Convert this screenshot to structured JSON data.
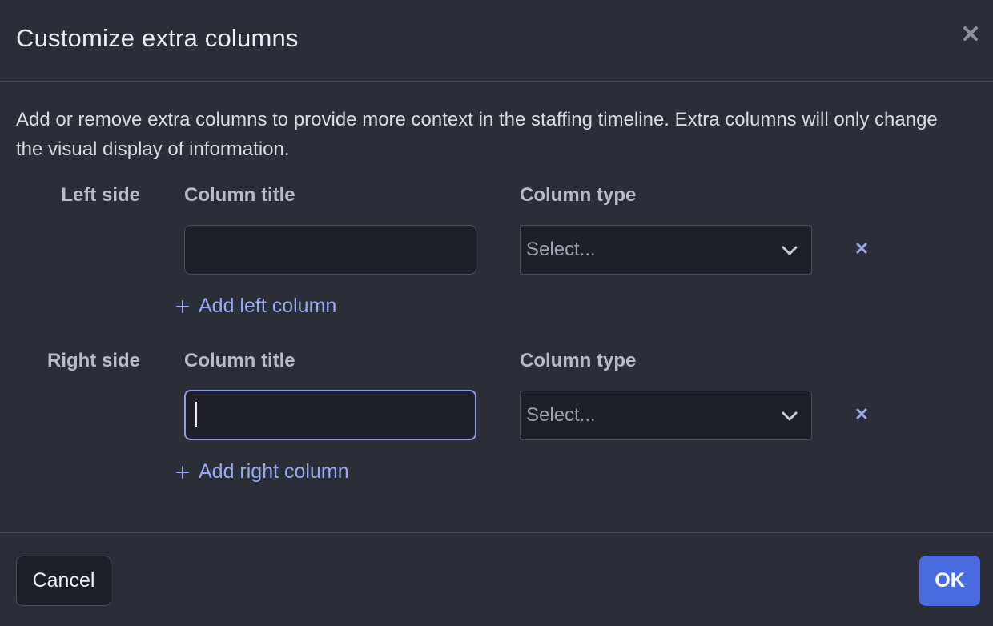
{
  "dialog": {
    "title": "Customize extra columns",
    "description": "Add or remove extra columns to provide more context in the staffing timeline. Extra columns will only change the visual display of information."
  },
  "left_side": {
    "label": "Left side",
    "column_title_label": "Column title",
    "column_type_label": "Column type",
    "column_title_value": "",
    "column_type_placeholder": "Select...",
    "add_label": "Add left column"
  },
  "right_side": {
    "label": "Right side",
    "column_title_label": "Column title",
    "column_type_label": "Column type",
    "column_title_value": "",
    "column_type_placeholder": "Select...",
    "add_label": "Add right column"
  },
  "footer": {
    "cancel_label": "Cancel",
    "ok_label": "OK"
  },
  "icons": {
    "close": "close-icon",
    "remove": "x-icon",
    "add": "plus-icon",
    "dropdown": "chevron-down-icon"
  },
  "colors": {
    "background": "#2b2e37",
    "input_background": "#1f2027",
    "accent": "#4a6be0",
    "link": "#9aa8f0",
    "focus_border": "#8f9de8"
  }
}
